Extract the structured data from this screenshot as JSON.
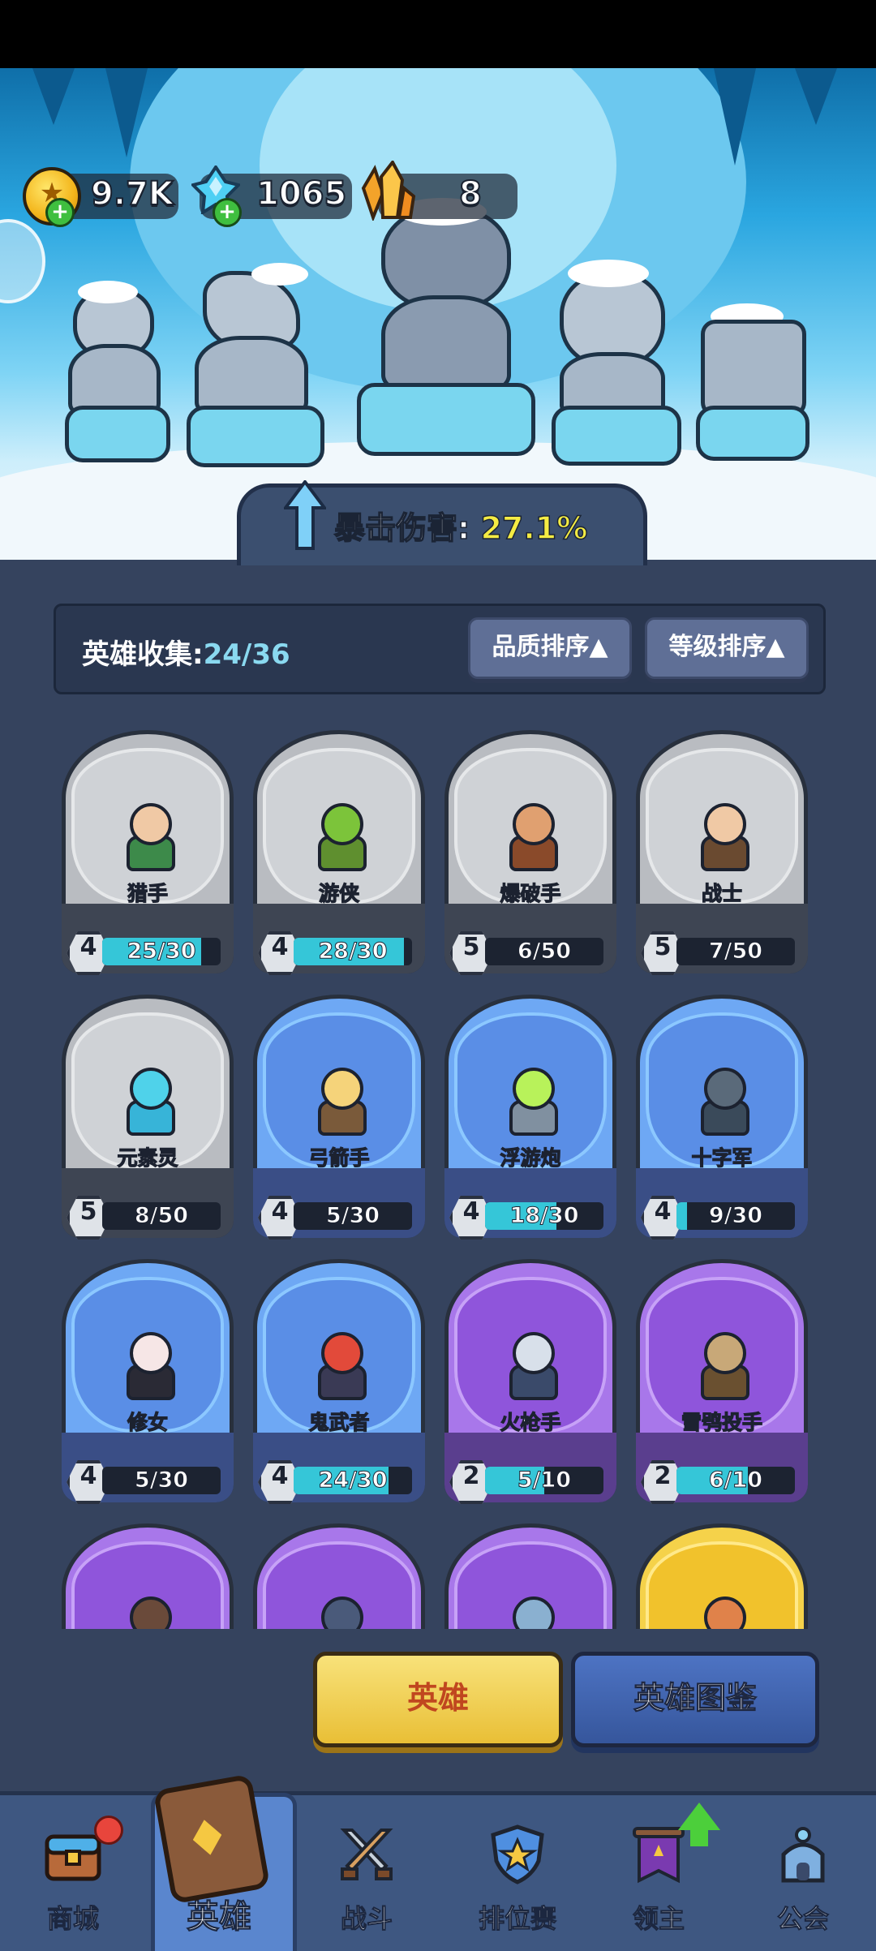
{
  "currency": {
    "coins": "9.7K",
    "gems": "1065",
    "crystals": "8"
  },
  "banner": {
    "crit_label": "暴击伤害:",
    "crit_value": "27.1%"
  },
  "collection": {
    "label": "英雄收集:",
    "value": "24/36",
    "sort_quality": "品质排序▲",
    "sort_level": "等级排序▲"
  },
  "heroes": [
    {
      "name": "猎手",
      "level": "4",
      "progress": "25/30",
      "fill": 0.833,
      "rarity": "gray",
      "colors": {
        "head": "#f0c9a5",
        "body": "#3d8a4a"
      }
    },
    {
      "name": "游侠",
      "level": "4",
      "progress": "28/30",
      "fill": 0.933,
      "rarity": "gray",
      "colors": {
        "head": "#7cc43a",
        "body": "#5f8f2f"
      }
    },
    {
      "name": "爆破手",
      "level": "5",
      "progress": "6/50",
      "fill": 0.0,
      "rarity": "gray",
      "colors": {
        "head": "#e0a070",
        "body": "#8a4a2a"
      }
    },
    {
      "name": "战士",
      "level": "5",
      "progress": "7/50",
      "fill": 0.0,
      "rarity": "gray",
      "colors": {
        "head": "#f0c9a5",
        "body": "#6a4a30"
      }
    },
    {
      "name": "元素灵",
      "level": "5",
      "progress": "8/50",
      "fill": 0.0,
      "rarity": "gray",
      "colors": {
        "head": "#4fd2ea",
        "body": "#37b4d8"
      }
    },
    {
      "name": "弓箭手",
      "level": "4",
      "progress": "5/30",
      "fill": 0.0,
      "rarity": "blue",
      "colors": {
        "head": "#f5d37a",
        "body": "#7a5a3a"
      }
    },
    {
      "name": "浮游炮",
      "level": "4",
      "progress": "18/30",
      "fill": 0.6,
      "rarity": "blue",
      "colors": {
        "head": "#b8f25a",
        "body": "#8090a0"
      }
    },
    {
      "name": "十字军",
      "level": "4",
      "progress": "9/30",
      "fill": 0.09,
      "rarity": "blue",
      "colors": {
        "head": "#5a6a7a",
        "body": "#3a4a5a"
      }
    },
    {
      "name": "修女",
      "level": "4",
      "progress": "5/30",
      "fill": 0.0,
      "rarity": "blue",
      "colors": {
        "head": "#f6e6e6",
        "body": "#2a2a35"
      }
    },
    {
      "name": "鬼武者",
      "level": "4",
      "progress": "24/30",
      "fill": 0.8,
      "rarity": "blue",
      "colors": {
        "head": "#e24a3a",
        "body": "#3a3a55"
      }
    },
    {
      "name": "火枪手",
      "level": "2",
      "progress": "5/10",
      "fill": 0.5,
      "rarity": "purple",
      "colors": {
        "head": "#d8e0ea",
        "body": "#3a4a6a"
      }
    },
    {
      "name": "雪鸮投手",
      "level": "2",
      "progress": "6/10",
      "fill": 0.6,
      "rarity": "purple",
      "colors": {
        "head": "#c8a878",
        "body": "#6a5030"
      }
    },
    {
      "name": "",
      "level": "",
      "progress": "",
      "fill": 0,
      "rarity": "purple",
      "colors": {
        "head": "#6a4a3a",
        "body": "#6a4a3a"
      }
    },
    {
      "name": "",
      "level": "",
      "progress": "",
      "fill": 0,
      "rarity": "purple",
      "colors": {
        "head": "#4a5a7a",
        "body": "#4a5a7a"
      }
    },
    {
      "name": "",
      "level": "",
      "progress": "",
      "fill": 0,
      "rarity": "purple",
      "colors": {
        "head": "#8ab0d0",
        "body": "#8ab0d0"
      }
    },
    {
      "name": "",
      "level": "",
      "progress": "",
      "fill": 0,
      "rarity": "gold",
      "colors": {
        "head": "#e0824a",
        "body": "#c05a2a"
      }
    }
  ],
  "actions": {
    "heroes_button": "英雄",
    "codex_button": "英雄图鉴"
  },
  "nav": [
    {
      "label": "商城",
      "icon": "shop-chest-icon"
    },
    {
      "label": "英雄",
      "icon": "hero-card-icon",
      "active": true
    },
    {
      "label": "战斗",
      "icon": "crossed-swords-icon"
    },
    {
      "label": "排位赛",
      "icon": "rank-shield-icon"
    },
    {
      "label": "领主",
      "icon": "lord-banner-icon"
    },
    {
      "label": "公会",
      "icon": "guild-castle-icon"
    }
  ]
}
